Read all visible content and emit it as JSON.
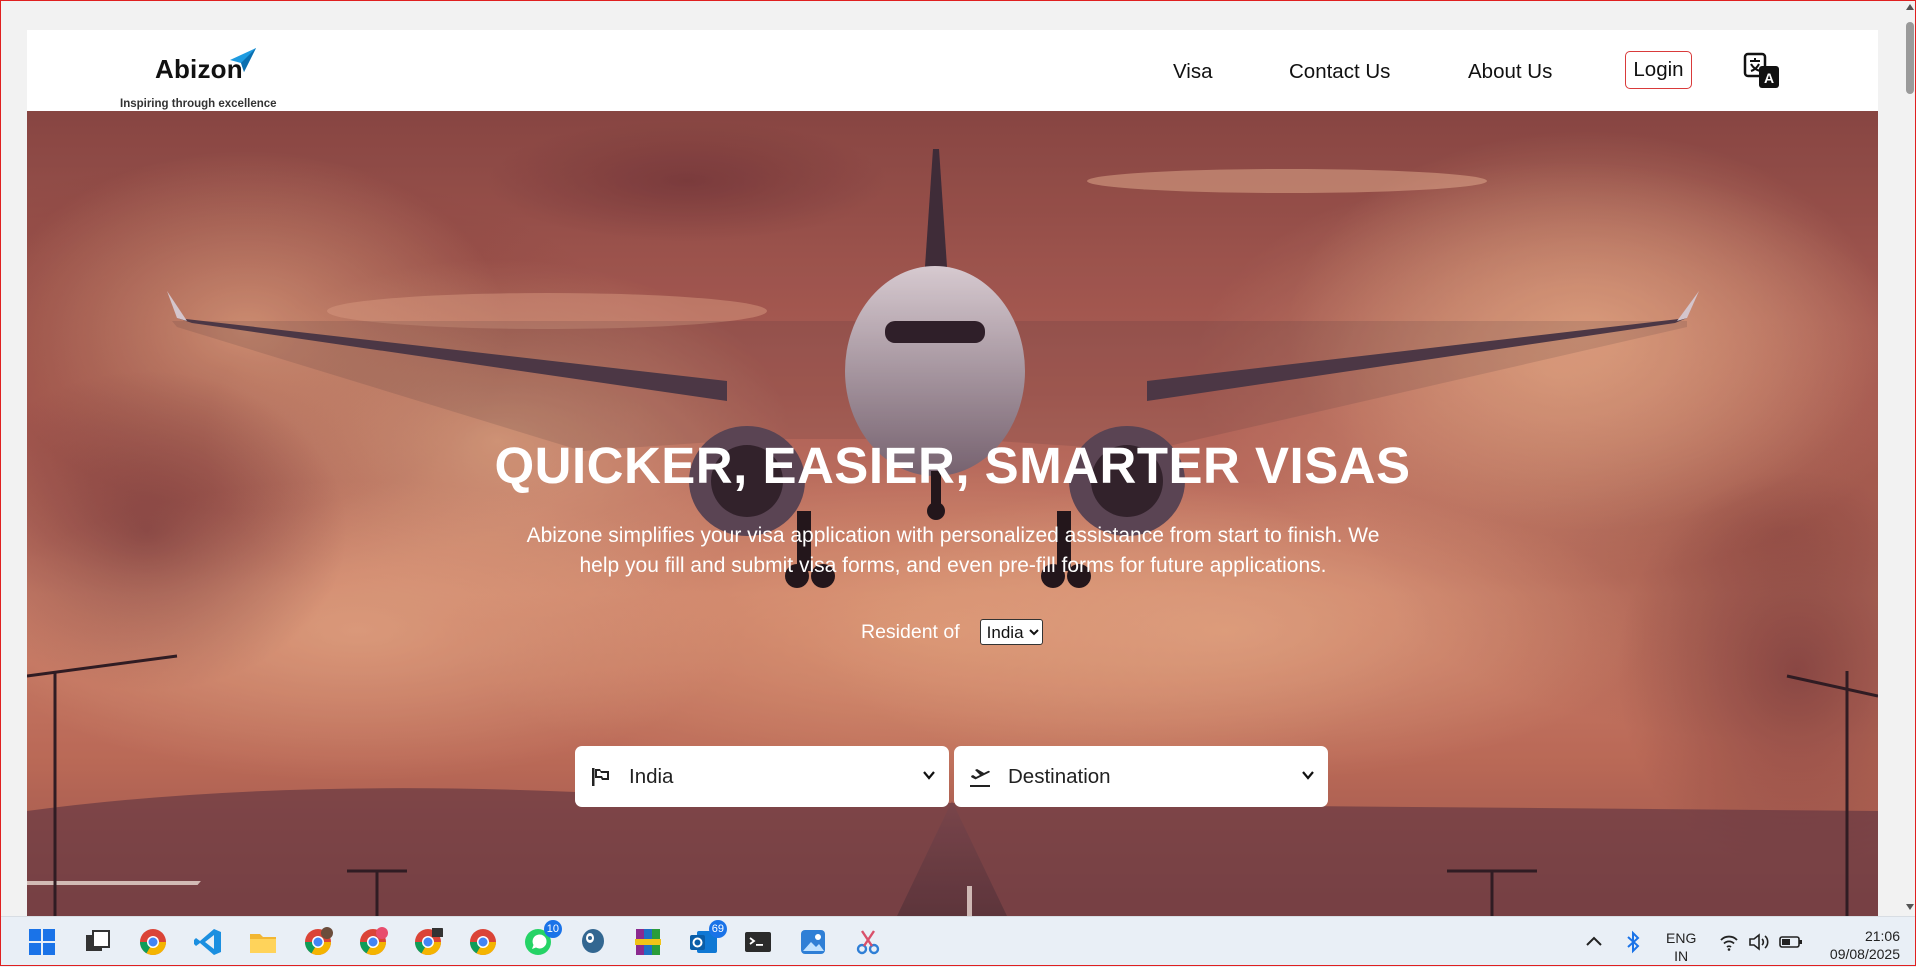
{
  "logo": {
    "name": "Abizon",
    "tagline": "Inspiring through excellence"
  },
  "nav": {
    "items": [
      "Visa",
      "Contact Us",
      "About Us"
    ],
    "login_label": "Login",
    "translate_icon": "translate-icon"
  },
  "hero": {
    "title": "QUICKER, EASIER, SMARTER VISAS",
    "description": "Abizone simplifies your visa application with personalized assistance from start to finish. We help you fill and submit visa forms, and even pre-fill forms for future applications.",
    "resident_label": "Resident of",
    "resident_value": "India",
    "origin_value": "India",
    "destination_value": "Destination",
    "origin_icon": "flag-icon",
    "destination_icon": "airplane-takeoff-icon"
  },
  "taskbar": {
    "badges": {
      "whatsapp": "10",
      "outlook": "69"
    },
    "language": {
      "line1": "ENG",
      "line2": "IN"
    },
    "time": "21:06",
    "date": "09/08/2025"
  },
  "colors": {
    "login_border": "#d93a3a",
    "hero_tint": "#c8735d",
    "taskbar": "#e9eff6"
  }
}
